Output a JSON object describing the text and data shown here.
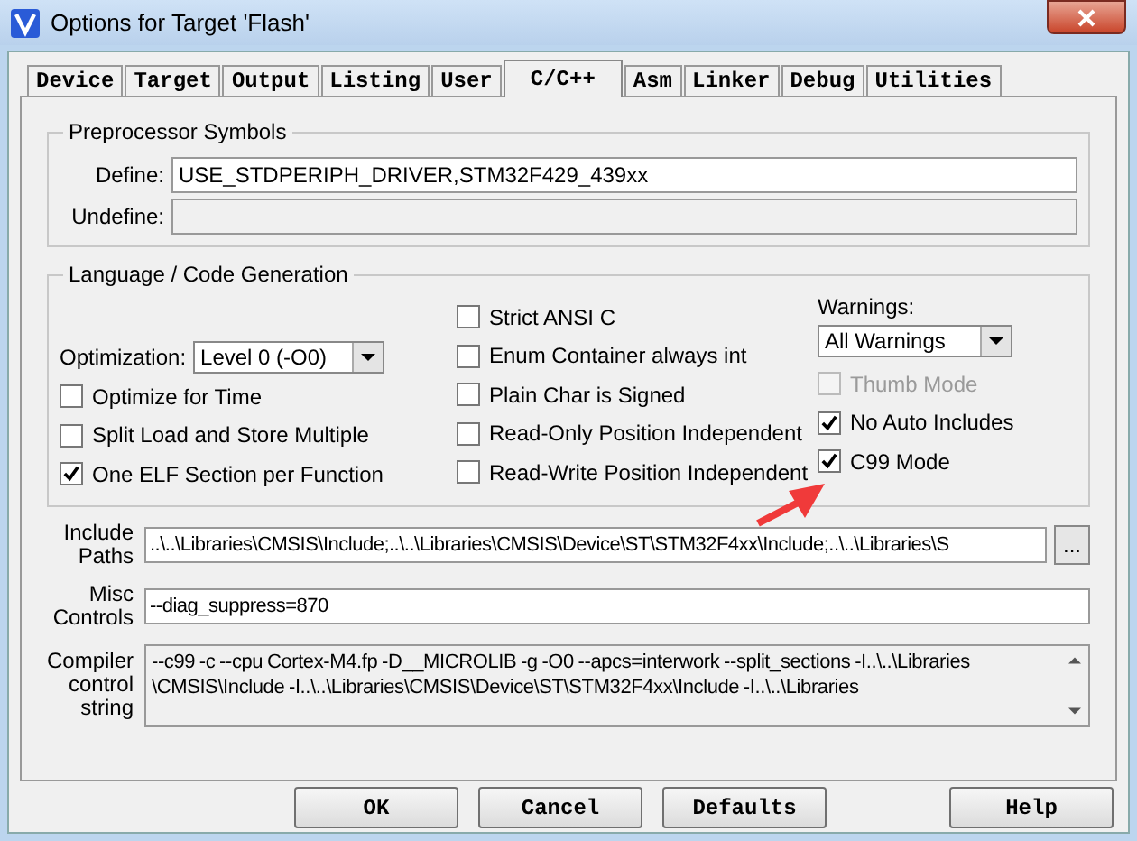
{
  "window": {
    "title": "Options for Target 'Flash'"
  },
  "tabs": [
    {
      "label": "Device",
      "selected": false
    },
    {
      "label": "Target",
      "selected": false
    },
    {
      "label": "Output",
      "selected": false
    },
    {
      "label": "Listing",
      "selected": false
    },
    {
      "label": "User",
      "selected": false
    },
    {
      "label": "C/C++",
      "selected": true
    },
    {
      "label": "Asm",
      "selected": false
    },
    {
      "label": "Linker",
      "selected": false
    },
    {
      "label": "Debug",
      "selected": false
    },
    {
      "label": "Utilities",
      "selected": false
    }
  ],
  "preprocessor": {
    "title": "Preprocessor Symbols",
    "define": {
      "label": "Define:",
      "value": "USE_STDPERIPH_DRIVER,STM32F429_439xx"
    },
    "undefine": {
      "label": "Undefine:",
      "disabled": true
    }
  },
  "language": {
    "title": "Language / Code Generation",
    "optimization": {
      "label": "Optimization:",
      "value": "Level 0 (-O0)"
    },
    "left_options": [
      {
        "label": "Optimize for Time",
        "checked": false,
        "disabled": false
      },
      {
        "label": "Split Load and Store Multiple",
        "checked": false,
        "disabled": false
      },
      {
        "label": "One ELF Section per Function",
        "checked": true,
        "disabled": false
      }
    ],
    "middle_options": [
      {
        "label": "Strict ANSI C",
        "checked": false,
        "disabled": false
      },
      {
        "label": "Enum Container always int",
        "checked": false,
        "disabled": false
      },
      {
        "label": "Plain Char is Signed",
        "checked": false,
        "disabled": false
      },
      {
        "label": "Read-Only Position Independent",
        "checked": false,
        "disabled": false
      },
      {
        "label": "Read-Write Position Independent",
        "checked": false,
        "disabled": false
      }
    ],
    "warnings": {
      "label": "Warnings:",
      "value": "All Warnings"
    },
    "right_options": [
      {
        "label": "Thumb Mode",
        "checked": false,
        "disabled": true
      },
      {
        "label": "No Auto Includes",
        "checked": true,
        "disabled": false
      },
      {
        "label": "C99 Mode",
        "checked": true,
        "disabled": false
      }
    ]
  },
  "include_paths": {
    "label": "Include Paths",
    "value": "..\\..\\Libraries\\CMSIS\\Include;..\\..\\Libraries\\CMSIS\\Device\\ST\\STM32F4xx\\Include;..\\..\\Libraries\\S",
    "browse": "..."
  },
  "misc_controls": {
    "label": "Misc Controls",
    "value": "--diag_suppress=870"
  },
  "compiler_string": {
    "label": "Compiler control string",
    "value": "--c99 -c --cpu Cortex-M4.fp -D__MICROLIB -g -O0 --apcs=interwork --split_sections -I..\\..\\Libraries \\CMSIS\\Include -I..\\..\\Libraries\\CMSIS\\Device\\ST\\STM32F4xx\\Include -I..\\..\\Libraries"
  },
  "buttons": [
    {
      "label": "OK",
      "kind": "normal"
    },
    {
      "label": "Cancel",
      "kind": "normal"
    },
    {
      "label": "Defaults",
      "kind": "normal"
    },
    {
      "label": "Help",
      "kind": "help"
    }
  ]
}
